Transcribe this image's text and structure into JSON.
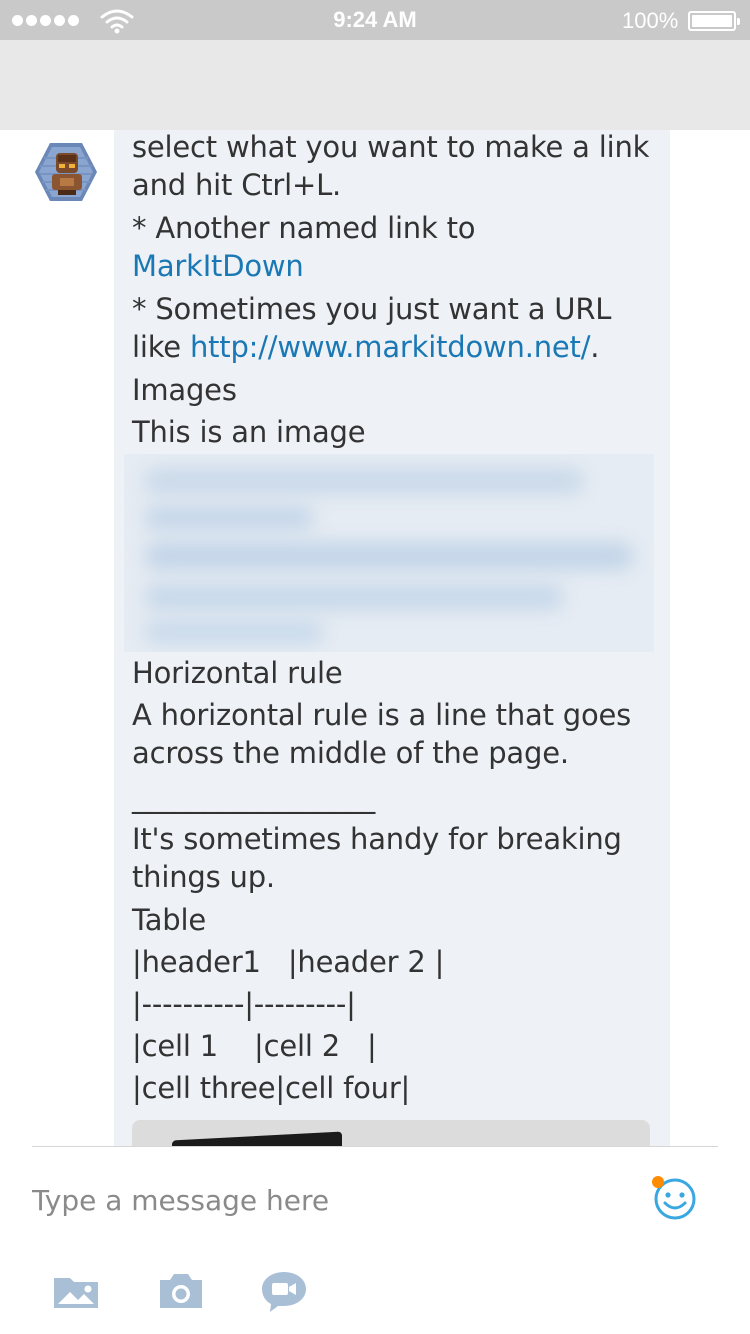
{
  "status_bar": {
    "time": "9:24 AM",
    "battery_percent": "100%",
    "signal_icon": "signal-dots-icon",
    "wifi_icon": "wifi-icon",
    "battery_icon": "battery-icon"
  },
  "message": {
    "avatar_icon": "bot-avatar-icon",
    "lines": [
      "select what you want to make a link",
      "and hit Ctrl+L.",
      "* Another named link to",
      "MarkItDown",
      "* Sometimes you just want a URL",
      "like ",
      "http://www.markitdown.net/",
      ".",
      "Images",
      "This is an image",
      "Horizontal rule",
      "A horizontal rule is a line that goes",
      "across the middle of the page.",
      "_________________",
      "It's sometimes handy for breaking",
      "things up.",
      "Table",
      "|header1   |header 2 |",
      "|----------|---------|",
      "|cell 1    |cell 2   |",
      "|cell three|cell four|"
    ],
    "link_color": "#1a78b4",
    "bubble_color": "#eef2f7"
  },
  "composer": {
    "placeholder": "Type a message here",
    "emoji_icon": "smiley-icon"
  },
  "toolbar": {
    "items": [
      {
        "icon": "gallery-icon"
      },
      {
        "icon": "camera-icon"
      },
      {
        "icon": "video-message-icon"
      }
    ]
  },
  "colors": {
    "accent": "#3aa8e0",
    "notification": "#ff8c00",
    "status_bar": "#c9c9c9"
  }
}
